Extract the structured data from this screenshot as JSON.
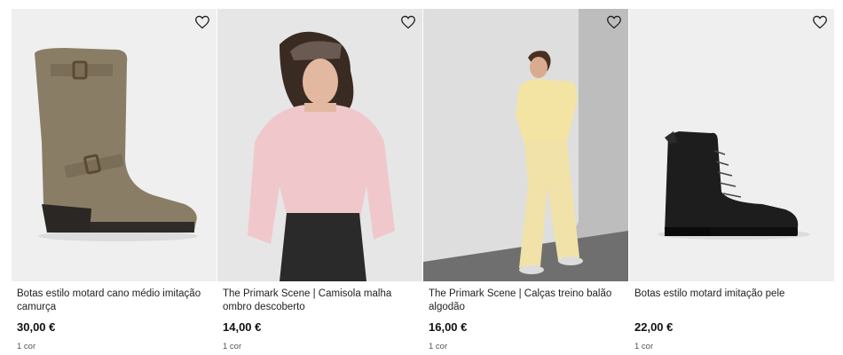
{
  "products": [
    {
      "title": "Botas estilo motard cano médio imitação camurça",
      "price": "30,00 €",
      "colors": "1 cor",
      "image": "tan-suede-biker-boot",
      "bg_color": "#efefef"
    },
    {
      "title": "The Primark Scene | Camisola malha ombro descoberto",
      "price": "14,00 €",
      "colors": "1 cor",
      "image": "woman-pink-off-shoulder-knit",
      "bg_color": "#e4e4e4"
    },
    {
      "title": "The Primark Scene | Calças treino balão algodão",
      "price": "16,00 €",
      "colors": "1 cor",
      "image": "woman-yellow-tracksuit-leaning",
      "bg_color": "#d9d9d9"
    },
    {
      "title": "Botas estilo motard imitação pele",
      "price": "22,00 €",
      "colors": "1 cor",
      "image": "black-leather-lace-up-boot",
      "bg_color": "#efefef"
    }
  ],
  "icons": {
    "favorite": "heart-outline-icon"
  },
  "colors": {
    "text": "#222222",
    "price": "#111111",
    "muted": "#555555"
  }
}
